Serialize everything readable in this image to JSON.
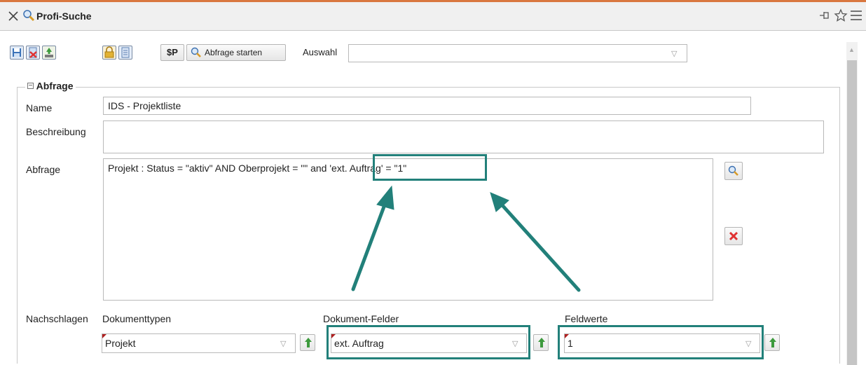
{
  "window": {
    "title": "Profi-Suche"
  },
  "toolbar": {
    "run_query_label": "Abfrage starten",
    "variable_label": "$P",
    "selection_label": "Auswahl",
    "selection_value": ""
  },
  "form": {
    "section_title": "Abfrage",
    "name_label": "Name",
    "name_value": "IDS - Projektliste",
    "description_label": "Beschreibung",
    "description_value": "",
    "query_label": "Abfrage",
    "query_value": "Projekt : Status = \"aktiv\" AND Oberprojekt = \"\" and 'ext. Auftrag' = \"1\"",
    "lookup_label": "Nachschlagen",
    "doctypes_label": "Dokumenttypen",
    "doctypes_value": "Projekt",
    "docfields_label": "Dokument-Felder",
    "docfields_value": "ext. Auftrag",
    "fieldvalues_label": "Feldwerte",
    "fieldvalues_value": "1"
  },
  "colors": {
    "highlight": "#22807a",
    "accent_top": "#d9773f",
    "delete_red": "#e03131",
    "arrow_up_green": "#3d9a3d"
  }
}
